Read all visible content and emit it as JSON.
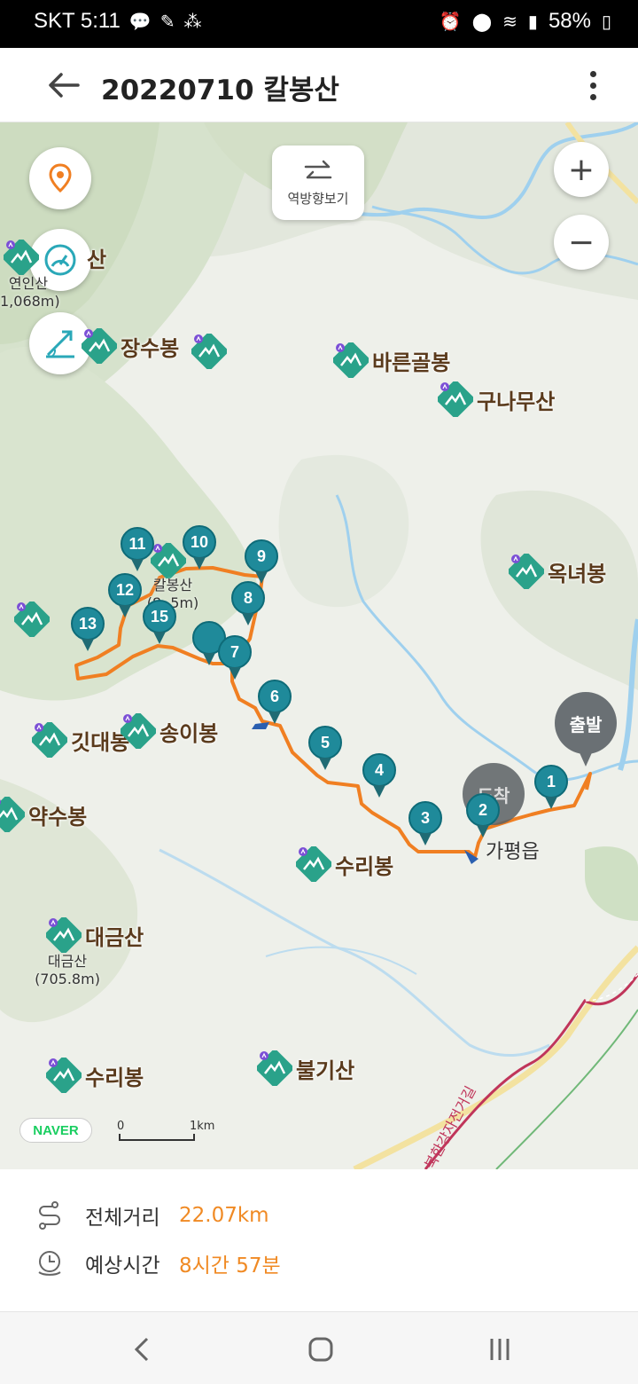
{
  "status_bar": {
    "carrier_time": "SKT 5:11",
    "battery": "58%",
    "icons": [
      "talk-icon",
      "pen-icon",
      "shoe-icon",
      "alarm-icon",
      "location-icon",
      "wifi-icon",
      "signal-icon",
      "battery-icon"
    ]
  },
  "header": {
    "title": "20220710 칼봉산",
    "back_icon": "arrow-left-icon",
    "more_icon": "more-vertical-icon"
  },
  "map": {
    "reverse_label": "역방향보기",
    "zoom_in": "+",
    "zoom_out": "−",
    "peaks": [
      {
        "name": "산",
        "sub": "연인산\n1,068m)"
      },
      {
        "name": "장수봉"
      },
      {
        "name": "바른골봉"
      },
      {
        "name": "구나무산"
      },
      {
        "name": "옥녀봉"
      },
      {
        "name": "깃대봉"
      },
      {
        "name": "송이봉"
      },
      {
        "name": "약수봉"
      },
      {
        "name": "수리봉"
      },
      {
        "name": "대금산",
        "sub": "대금산\n(705.8m)"
      },
      {
        "name": "수리봉"
      },
      {
        "name": "불기산"
      },
      {
        "name": "",
        "sub": "칼봉산\n(8  .5m)"
      }
    ],
    "waypoints": [
      "1",
      "2",
      "3",
      "4",
      "5",
      "6",
      "7",
      "8",
      "9",
      "10",
      "11",
      "12",
      "13",
      "15",
      ""
    ],
    "start_label": "출발",
    "end_label": "도착",
    "town": "가평읍",
    "provider": "NAVER",
    "scale": {
      "start": "0",
      "end": "1km"
    },
    "road": "북한강자전거길",
    "colors": {
      "route": "#f07f22",
      "waypoint": "#1f8a9a",
      "accent": "#f08a24",
      "provider": "#19ce60"
    }
  },
  "summary": {
    "distance_label": "전체거리",
    "distance_value": "22.07km",
    "time_label": "예상시간",
    "time_value": "8시간 57분"
  },
  "navbar": {
    "back": "back-nav-icon",
    "home": "home-nav-icon",
    "recents": "recents-nav-icon"
  }
}
